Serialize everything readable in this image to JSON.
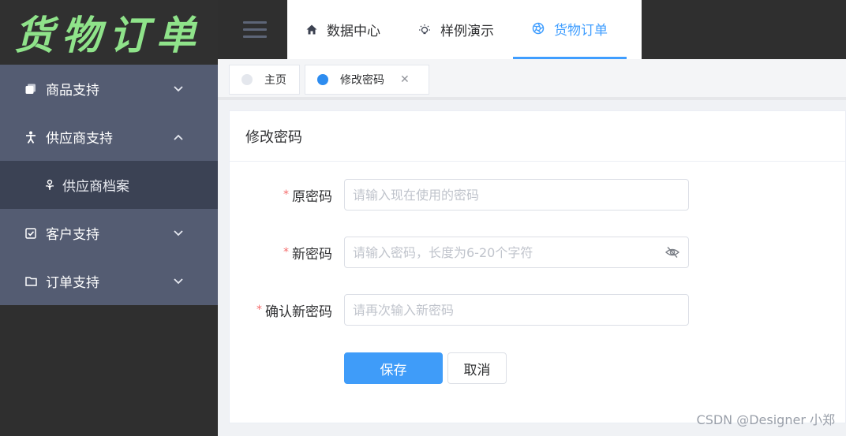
{
  "logo": {
    "text": "货物订单"
  },
  "sidebar": {
    "items": [
      {
        "label": "商品支持",
        "icon": "copy-icon",
        "chevron": "⌄"
      },
      {
        "label": "供应商支持",
        "icon": "person-icon",
        "chevron": "⌃"
      },
      {
        "label": "供应商档案",
        "icon": "flower-icon"
      },
      {
        "label": "客户支持",
        "icon": "checkbox-icon",
        "chevron": "⌄"
      },
      {
        "label": "订单支持",
        "icon": "folder-icon",
        "chevron": "⌄"
      }
    ]
  },
  "topnav": {
    "items": [
      {
        "label": "数据中心",
        "icon": "home-icon"
      },
      {
        "label": "样例演示",
        "icon": "lightbulb-icon"
      },
      {
        "label": "货物订单",
        "icon": "aperture-icon",
        "active": true
      }
    ]
  },
  "tags": [
    {
      "label": "主页",
      "dot_color": "#e4e7ed"
    },
    {
      "label": "修改密码",
      "dot_color": "#2d8cf0",
      "close": "✕"
    }
  ],
  "card": {
    "title": "修改密码",
    "fields": [
      {
        "label": "原密码",
        "required_mark": "*",
        "placeholder": "请输入现在使用的密码"
      },
      {
        "label": "新密码",
        "required_mark": "*",
        "placeholder": "请输入密码，长度为6-20个字符"
      },
      {
        "label": "确认新密码",
        "required_mark": "*",
        "placeholder": "请再次输入新密码"
      }
    ],
    "save_label": "保存",
    "cancel_label": "取消"
  },
  "watermark": "CSDN @Designer 小郑",
  "colors": {
    "accent": "#409eff",
    "sidebar": "#545c72",
    "logo": "#8fe38a",
    "required": "#f56c6c"
  }
}
